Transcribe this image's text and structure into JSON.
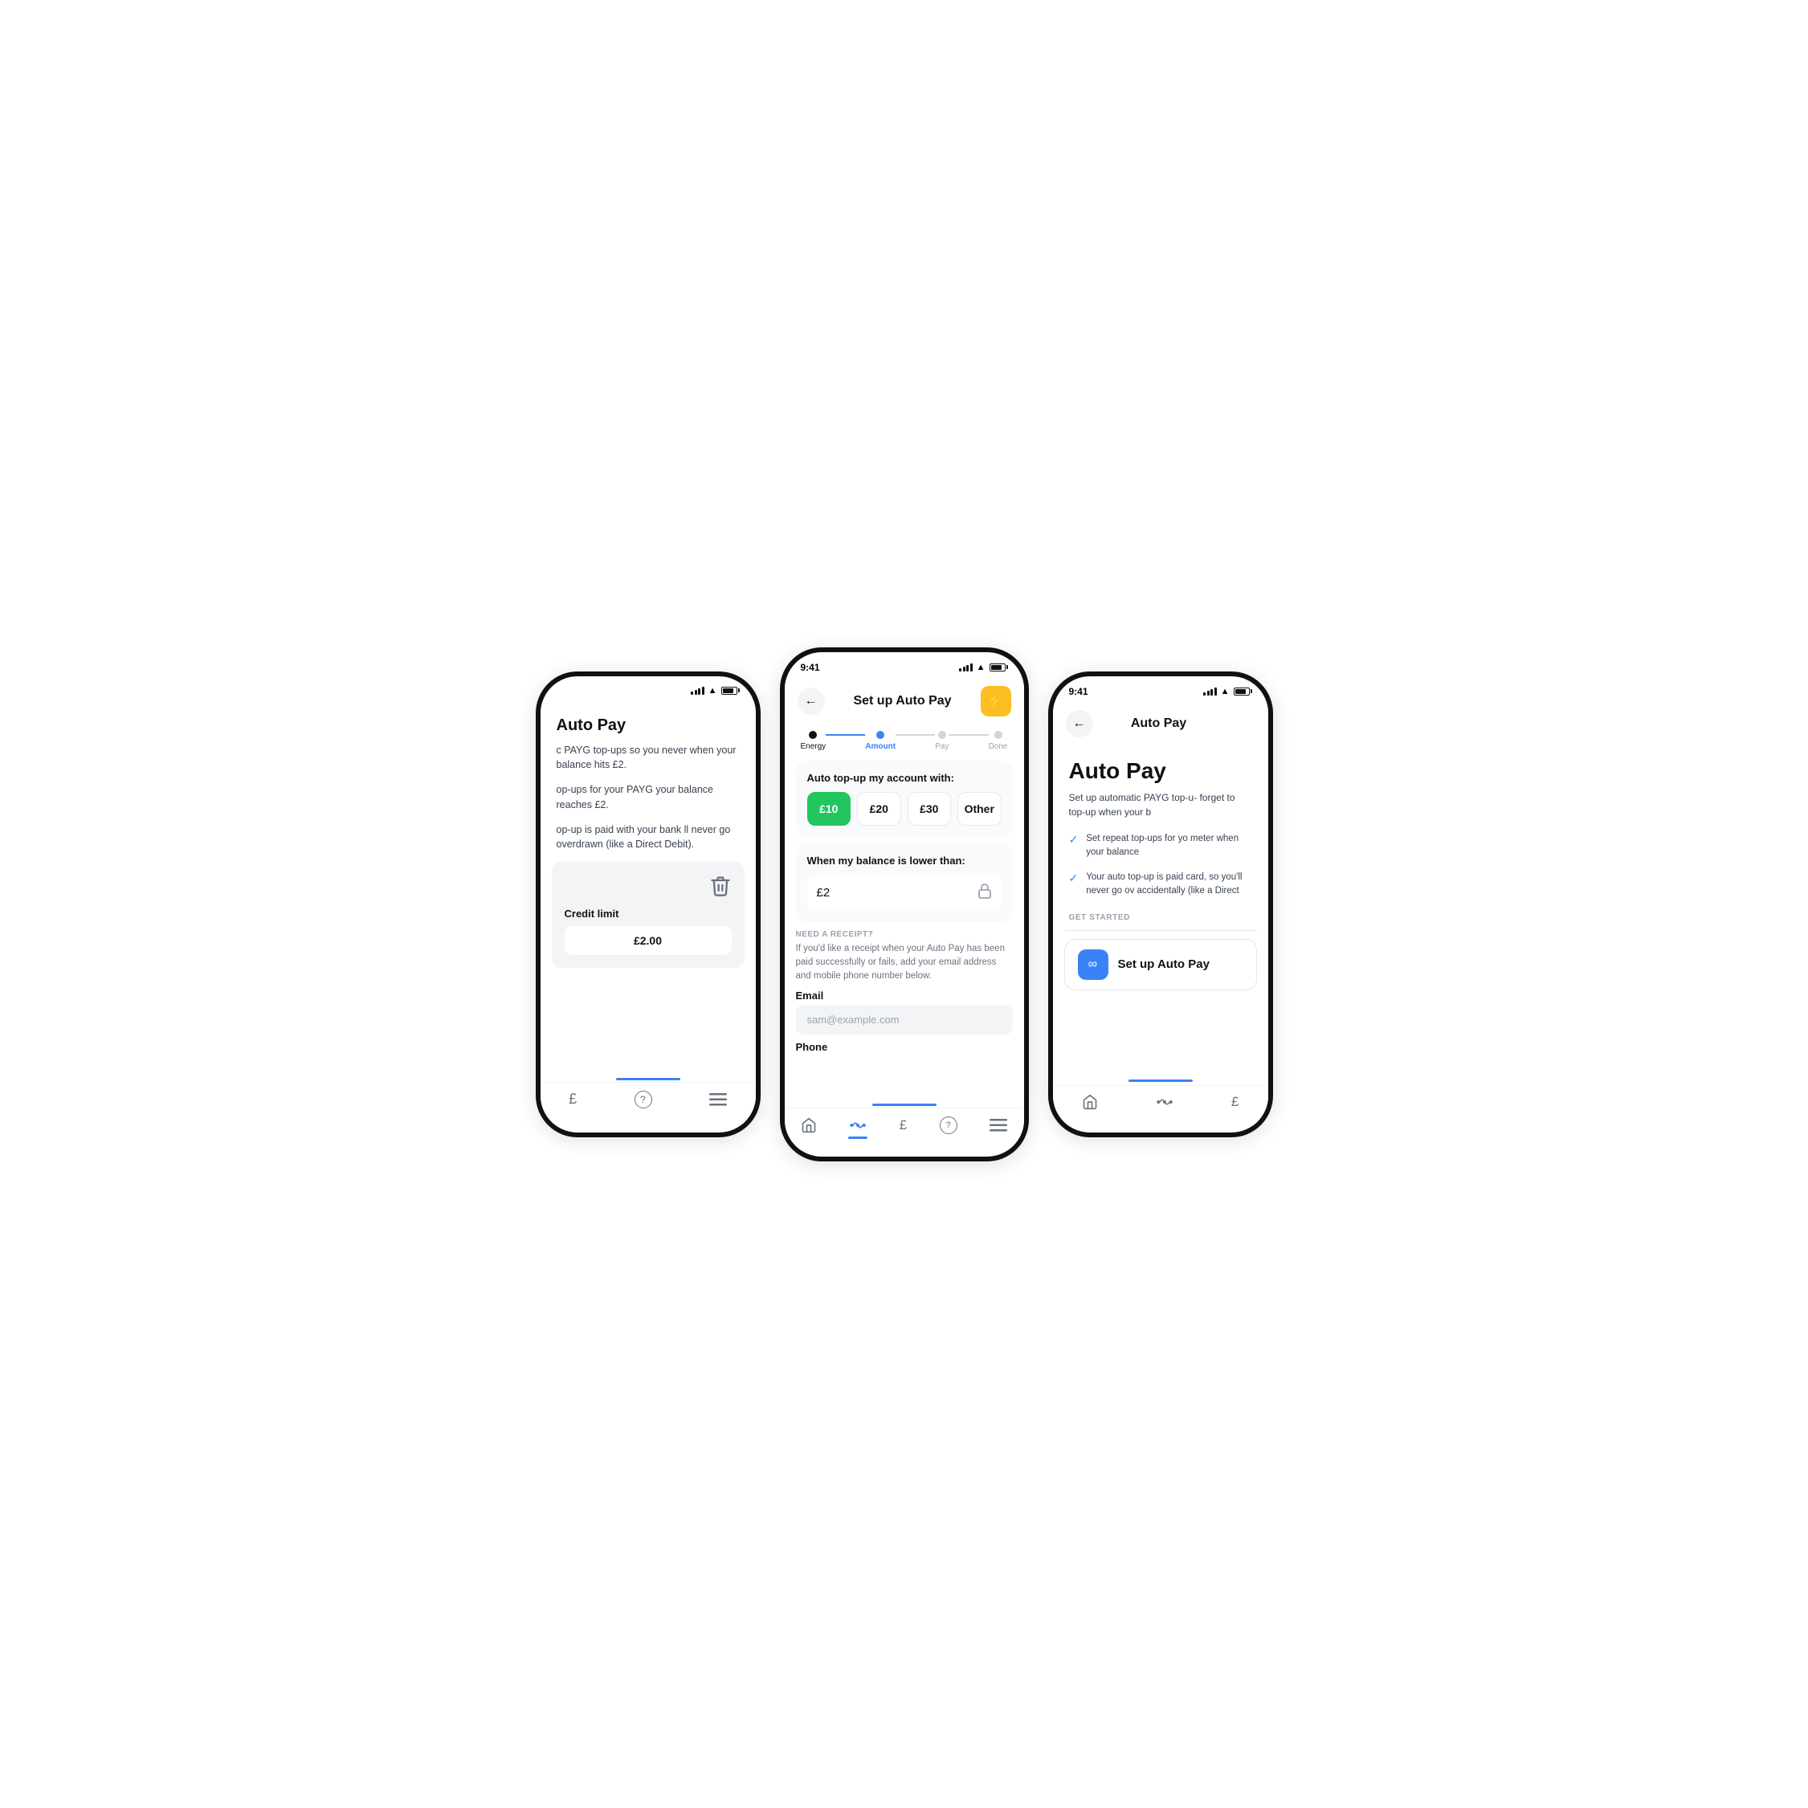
{
  "left_phone": {
    "title": "Auto Pay",
    "status_icons": true,
    "content_para1": "c PAYG top-ups so you never when your balance hits £2.",
    "content_para2": "op-ups for your PAYG your balance reaches £2.",
    "content_para3": "op-up is paid with your bank ll never go overdrawn (like a Direct Debit).",
    "credit_limit_label": "Credit limit",
    "credit_limit_value": "£2.00",
    "nav_items": [
      "£",
      "?",
      "≡"
    ]
  },
  "center_phone": {
    "time": "9:41",
    "nav_title": "Set up Auto Pay",
    "bolt_icon": "⚡",
    "steps": [
      {
        "label": "Energy",
        "state": "completed"
      },
      {
        "label": "Amount",
        "state": "active"
      },
      {
        "label": "Pay",
        "state": "upcoming"
      },
      {
        "label": "Done",
        "state": "upcoming"
      }
    ],
    "amount_card_title": "Auto top-up my account with:",
    "amounts": [
      {
        "value": "£10",
        "selected": true
      },
      {
        "value": "£20",
        "selected": false
      },
      {
        "value": "£30",
        "selected": false
      },
      {
        "value": "Other",
        "selected": false
      }
    ],
    "balance_card_title": "When my balance is lower than:",
    "balance_value": "£2",
    "receipt_label": "NEED A RECEIPT?",
    "receipt_text": "If you'd like a receipt when your Auto Pay has been paid successfully or fails, add your email address and mobile phone number below.",
    "email_label": "Email",
    "email_placeholder": "sam@example.com",
    "phone_label": "Phone",
    "nav_items": [
      "🏠",
      "⚙",
      "£",
      "?",
      "≡"
    ]
  },
  "right_phone": {
    "time": "9:41",
    "nav_title": "Auto Pay",
    "hero_title": "Auto Pay",
    "hero_text": "Set up automatic PAYG top-u- forget to top-up when your b",
    "check_items": [
      "Set repeat top-ups for yo meter when your balance",
      "Your auto top-up is paid card, so you'll never go ov accidentally (like a Direct"
    ],
    "get_started_label": "GET STARTED",
    "setup_btn_label": "Set up Auto Pay",
    "nav_items": [
      "🏠",
      "⚙",
      "£"
    ]
  }
}
